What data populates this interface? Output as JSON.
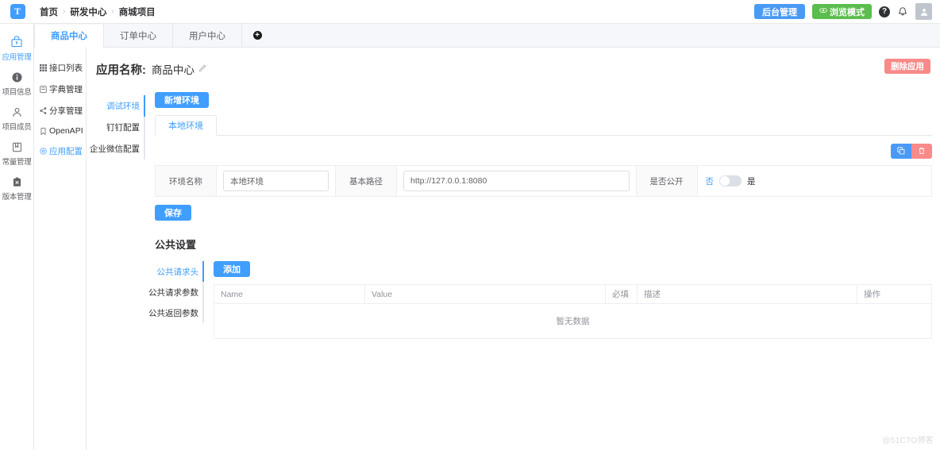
{
  "header": {
    "logo_text": "T",
    "breadcrumb": [
      "首页",
      "研发中心",
      "商城项目"
    ],
    "separator": "›",
    "admin_button": "后台管理",
    "browse_button": "浏览模式",
    "help_icon": "help-circle-icon",
    "bell_icon": "bell-icon",
    "avatar_icon": "user-avatar-icon"
  },
  "left_rail": {
    "items": [
      {
        "label": "应用管理",
        "icon": "app-box-icon",
        "active": true
      },
      {
        "label": "项目信息",
        "icon": "info-circle-icon",
        "active": false
      },
      {
        "label": "项目成员",
        "icon": "user-icon",
        "active": false
      },
      {
        "label": "常量管理",
        "icon": "book-icon",
        "active": false
      },
      {
        "label": "版本管理",
        "icon": "clipboard-icon",
        "active": false
      }
    ]
  },
  "tabstrip": {
    "tabs": [
      {
        "label": "商品中心",
        "active": true
      },
      {
        "label": "订单中心",
        "active": false
      },
      {
        "label": "用户中心",
        "active": false
      }
    ],
    "add_tab_icon": "plus-circle-icon"
  },
  "subnav": {
    "items": [
      {
        "label": "接口列表",
        "icon": "grid-icon",
        "active": false
      },
      {
        "label": "字典管理",
        "icon": "book-open-icon",
        "active": false
      },
      {
        "label": "分享管理",
        "icon": "share-icon",
        "active": false
      },
      {
        "label": "OpenAPI",
        "icon": "bookmark-icon",
        "active": false
      },
      {
        "label": "应用配置",
        "icon": "settings-gear-icon",
        "active": true
      }
    ]
  },
  "main": {
    "app_name_label": "应用名称:",
    "app_name_value": "商品中心",
    "edit_icon": "pencil-edit-icon",
    "delete_app_button": "删除应用",
    "env_vtabs": [
      {
        "label": "调试环境",
        "active": true
      },
      {
        "label": "钉钉配置",
        "active": false
      },
      {
        "label": "企业微信配置",
        "active": false
      }
    ],
    "add_env_button": "新增环境",
    "env_tabs": [
      {
        "label": "本地环境",
        "active": true
      }
    ],
    "copy_icon": "copy-icon",
    "trash_icon": "trash-icon",
    "form": {
      "env_name_label": "环境名称",
      "env_name_value": "本地环境",
      "base_path_label": "基本路径",
      "base_path_value": "http://127.0.0.1:8080",
      "public_label": "是否公开",
      "public_off_text": "否",
      "public_on_text": "是",
      "public_state": "off"
    },
    "save_button": "保存",
    "public_settings_title": "公共设置",
    "public_vtabs": [
      {
        "label": "公共请求头",
        "active": true
      },
      {
        "label": "公共请求参数",
        "active": false
      },
      {
        "label": "公共返回参数",
        "active": false
      }
    ],
    "add_button": "添加",
    "table": {
      "columns": [
        "Name",
        "Value",
        "必填",
        "描述",
        "操作"
      ],
      "rows": [],
      "empty_text": "暂无数据"
    }
  },
  "watermark": "@51CTO博客"
}
